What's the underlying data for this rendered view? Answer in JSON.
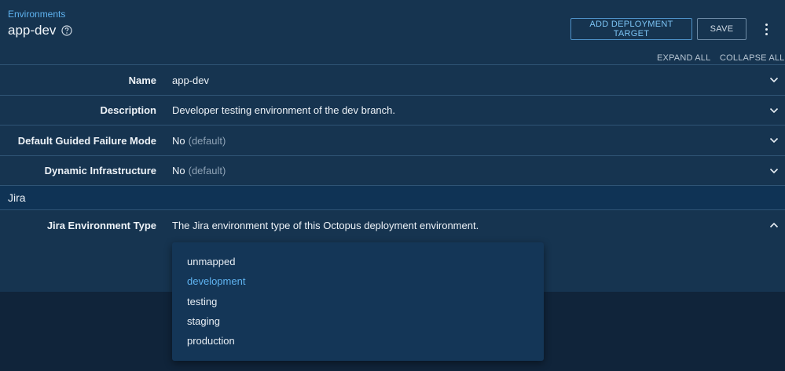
{
  "header": {
    "breadcrumb": "Environments",
    "title": "app-dev",
    "help_icon": "help-circle-icon"
  },
  "toolbar": {
    "add_target_label": "ADD DEPLOYMENT TARGET",
    "save_label": "SAVE",
    "more_icon": "more-vertical-icon"
  },
  "toggles": {
    "expand_all": "EXPAND ALL",
    "collapse_all": "COLLAPSE ALL"
  },
  "fields": [
    {
      "label": "Name",
      "value": "app-dev",
      "suffix": ""
    },
    {
      "label": "Description",
      "value": "Developer testing environment of the dev branch.",
      "suffix": ""
    },
    {
      "label": "Default Guided Failure Mode",
      "value": "No",
      "suffix": "(default)"
    },
    {
      "label": "Dynamic Infrastructure",
      "value": "No",
      "suffix": "(default)"
    }
  ],
  "jira": {
    "section_title": "Jira",
    "field_label": "Jira Environment Type",
    "field_value": "The Jira environment type of this Octopus deployment environment.",
    "options": [
      "unmapped",
      "development",
      "testing",
      "staging",
      "production"
    ],
    "selected": "development"
  },
  "colors": {
    "accent": "#5fb3f0",
    "background": "#163450",
    "section": "#0f3355"
  }
}
